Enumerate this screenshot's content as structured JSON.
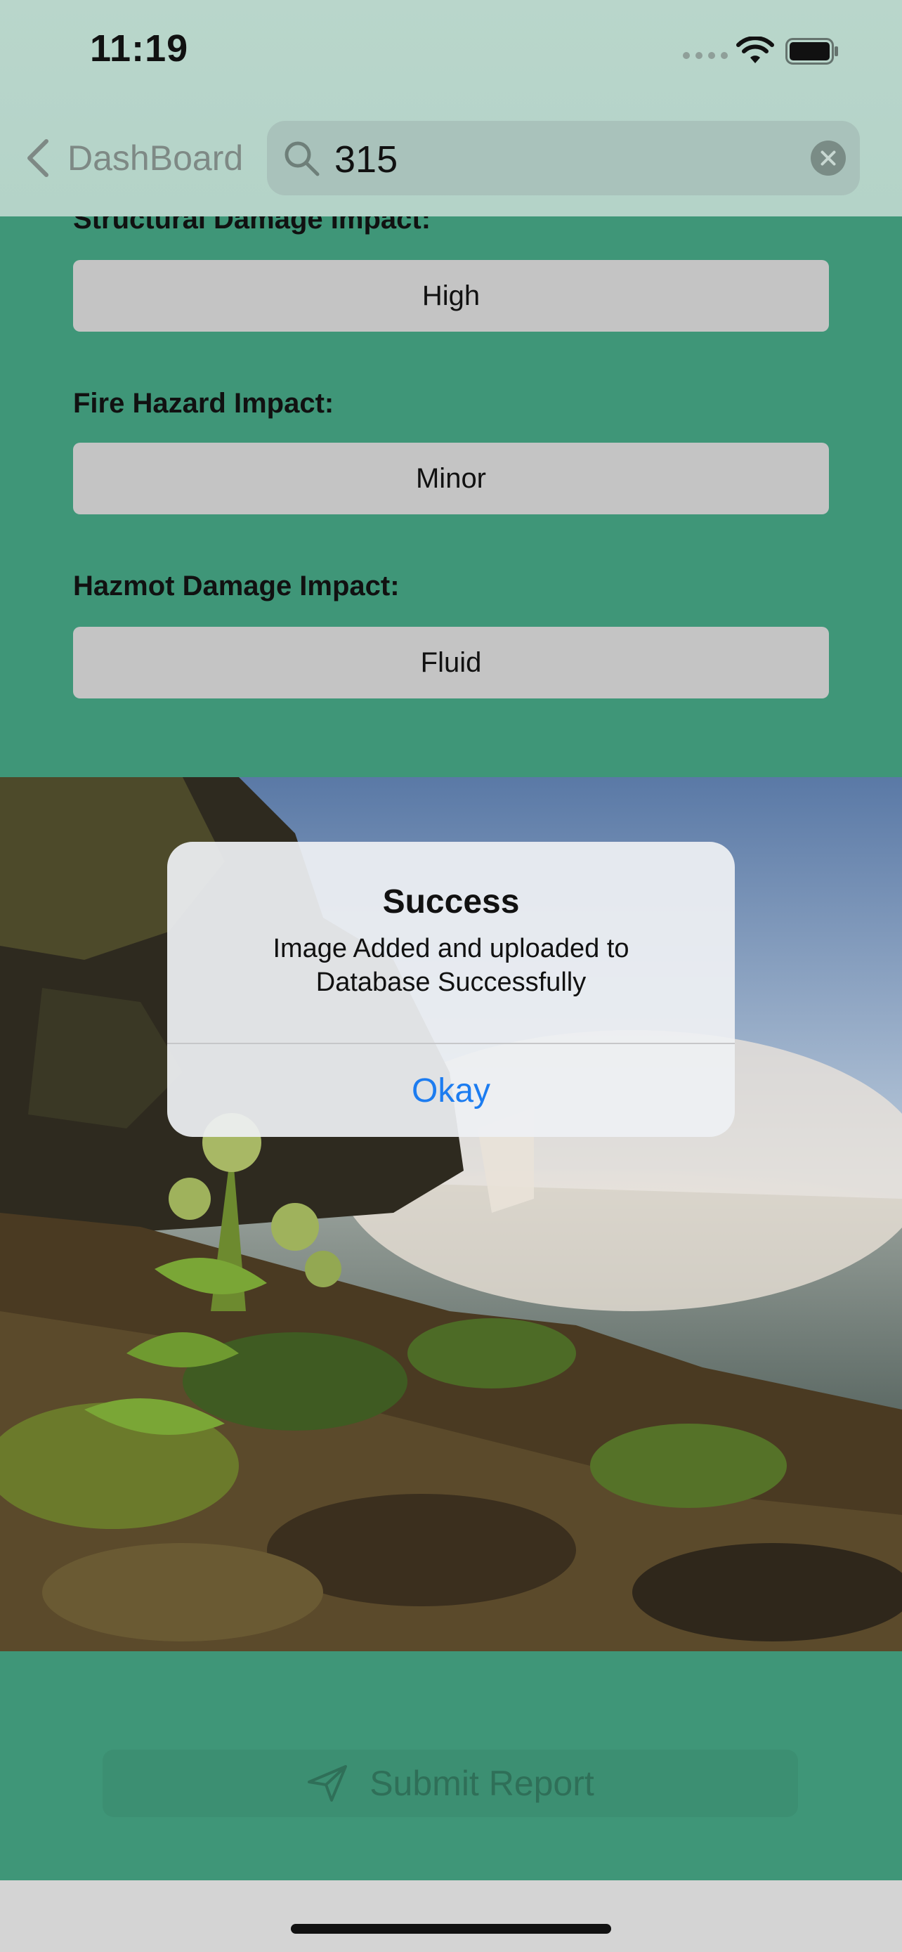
{
  "status_bar": {
    "time": "11:19"
  },
  "nav": {
    "back_label": "DashBoard",
    "search_value": "315"
  },
  "form": {
    "fields": [
      {
        "label": "Structural Damage Impact:",
        "value": "High"
      },
      {
        "label": "Fire Hazard Impact:",
        "value": "Minor"
      },
      {
        "label": "Hazmot Damage Impact:",
        "value": "Fluid"
      }
    ]
  },
  "alert": {
    "title": "Success",
    "message_line1": "Image Added and uploaded to",
    "message_line2": "Database Successfully",
    "button": "Okay"
  },
  "submit": {
    "label": "Submit Report"
  },
  "colors": {
    "background": "#3f9678",
    "alert_button": "#1c7cf0",
    "field_bg": "#c4c4c4"
  },
  "icons": [
    "chevron-left-icon",
    "search-icon",
    "clear-icon",
    "paper-plane-icon",
    "wifi-icon",
    "battery-icon",
    "cellular-signal-icon"
  ]
}
